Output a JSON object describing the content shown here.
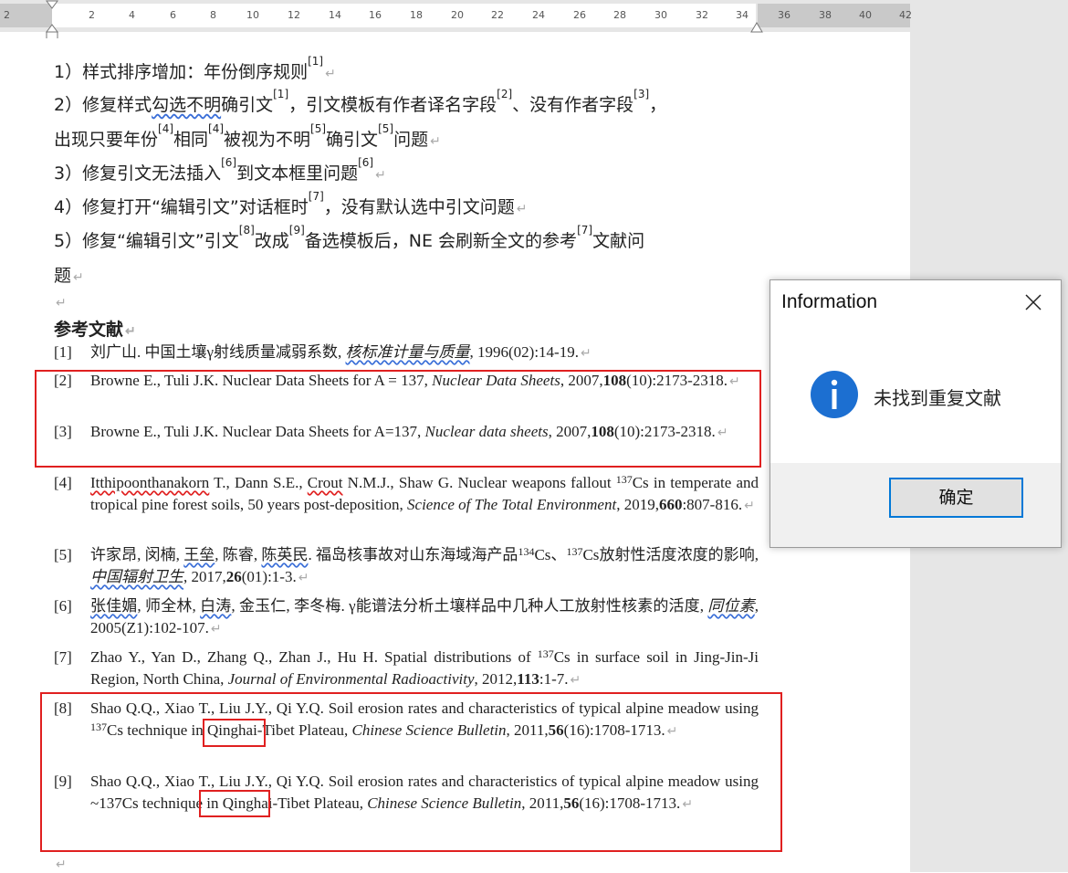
{
  "ruler": {
    "labels": [
      "2",
      "2",
      "4",
      "6",
      "8",
      "10",
      "12",
      "14",
      "16",
      "18",
      "20",
      "22",
      "24",
      "26",
      "28",
      "30",
      "32",
      "34",
      "36",
      "38",
      "40",
      "42"
    ]
  },
  "list_items": [
    {
      "pre": "1）样式排序增加：年份倒序规则",
      "sup1": "[1]"
    },
    {
      "l1": "2）修复样式勾选不明确引文",
      "s1": "[1]",
      "l2": "，引文模板有作者译名字段",
      "s2": "[2]",
      "l3": "、没有作者字段",
      "s3": "[3]",
      "l4": "，"
    },
    {
      "l1": "出现只要年份",
      "s1": "[4]",
      "l2": "相同",
      "s2": "[4]",
      "l3": "被视为不明",
      "s3": "[5]",
      "l4": "确引文",
      "s4": "[5]",
      "l5": "问题"
    },
    {
      "l1": "3）修复引文无法插入",
      "s1": "[6]",
      "l2": "到文本框里问题",
      "s2": "[6]"
    },
    {
      "l1": "4）修复打开“编辑引文”对话框时",
      "s1": "[7]",
      "l2": "，没有默认选中引文问题"
    },
    {
      "l1": "5）修复“编辑引文”引文",
      "s1": "[8]",
      "l2": "改成",
      "s2": "[9]",
      "l3": "备选模板后，NE 会刷新全文的参考",
      "s3": "[7]",
      "l4": "文献问"
    },
    {
      "l1": "题"
    }
  ],
  "para_mark": "↵",
  "heading": "参考文献",
  "references": [
    {
      "num": "[1]",
      "a": "刘广山. 中国土壤γ射线质量减弱系数, ",
      "journal": "核标准计量与质量",
      "b": ", 1996(02):14-19."
    },
    {
      "num": "[2]",
      "a": "Browne E., Tuli J.K. Nuclear Data Sheets for A = 137, ",
      "journal": "Nuclear Data Sheets",
      "b": ", 2007,",
      "vol": "108",
      "c": "(10):2173-2318."
    },
    {
      "num": "[3]",
      "a": "Browne E., Tuli J.K. Nuclear Data Sheets for A=137, ",
      "journal": "Nuclear data sheets",
      "b": ", 2007,",
      "vol": "108",
      "c": "(10):2173-2318."
    },
    {
      "num": "[4]",
      "a1": "Itthipoonthanakorn",
      "a2": " T., Dann S.E., ",
      "a3": "Crout",
      "a4": " N.M.J., Shaw G. Nuclear weapons fallout ",
      "sup": "137",
      "a5": "Cs in temperate and tropical pine forest soils, 50 years post-deposition, ",
      "journal": "Science of The Total Environment",
      "b": ", 2019,",
      "vol": "660",
      "c": ":807-816."
    },
    {
      "num": "[5]",
      "a1": "许家昂, 闵楠, ",
      "a2": "王垒",
      "a3": ", 陈睿, ",
      "a4": "陈英民",
      "a5": ". 福岛核事故对山东海域海产品",
      "sup1": "134",
      "a6": "Cs、",
      "sup2": "137",
      "a7": "Cs放射性活度浓度的影响, ",
      "journal": "中国辐射卫生",
      "b": ", 2017,",
      "vol": "26",
      "c": "(01):1-3."
    },
    {
      "num": "[6]",
      "a1": "张佳媚",
      "a2": ", 师全林, ",
      "a3": "白涛",
      "a4": ", 金玉仁, 李冬梅. γ能谱法分析土壤样品中几种人工放射性核素的活度, ",
      "journal": "同位素",
      "b": ", 2005(Z1):102-107."
    },
    {
      "num": "[7]",
      "a": "Zhao Y., Yan D., Zhang Q., Zhan J., Hu H. Spatial distributions of ",
      "sup": "137",
      "a2": "Cs in surface soil in Jing-Jin-Ji Region, North China, ",
      "journal": "Journal of Environmental Radioactivity",
      "b": ", 2012,",
      "vol": "113",
      "c": ":1-7."
    },
    {
      "num": "[8]",
      "a": "Shao Q.Q., Xiao T., Liu J.Y., Qi Y.Q. Soil erosion rates and characteristics of typical alpine meadow using ",
      "sup": "137",
      "iso": "Cs",
      "a2": " technique in Qinghai-Tibet Plateau, ",
      "journal": "Chinese Science Bulletin",
      "b": ", 2011,",
      "vol": "56",
      "c": "(16):1708-1713."
    },
    {
      "num": "[9]",
      "a": "Shao Q.Q., Xiao T., Liu J.Y., Qi Y.Q. Soil erosion rates and characteristics of typical alpine meadow using ",
      "iso": "~137Cs",
      "a2": " technique in Qinghai-Tibet Plateau, ",
      "journal": "Chinese Science Bulletin",
      "b": ", 2011,",
      "vol": "56",
      "c": "(16):1708-1713."
    }
  ],
  "dialog": {
    "title": "Information",
    "message": "未找到重复文献",
    "ok_label": "确定",
    "icon": "info-icon",
    "icon_color": "#1c6fd1"
  },
  "colors": {
    "highlight_box": "#e02020",
    "ok_border": "#0078d7"
  }
}
